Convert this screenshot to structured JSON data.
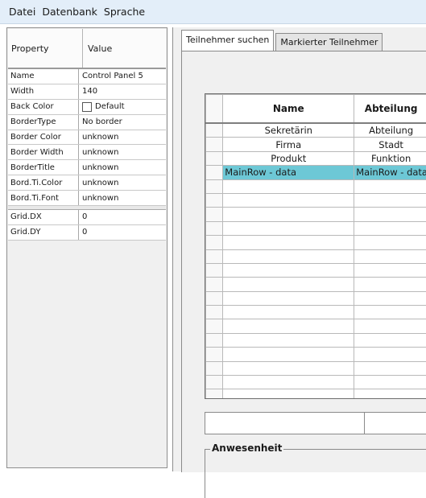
{
  "menu": [
    "Datei",
    "Datenbank",
    "Sprache"
  ],
  "props": {
    "header": {
      "name": "Property",
      "value": "Value"
    },
    "rows": [
      {
        "name": "Name",
        "value": "Control Panel 5"
      },
      {
        "name": "Width",
        "value": "140"
      },
      {
        "name": "Back Color",
        "value": "Default",
        "swatch": true
      },
      {
        "name": "BorderType",
        "value": "No border"
      },
      {
        "name": "Border Color",
        "value": "unknown"
      },
      {
        "name": "Border Width",
        "value": "unknown"
      },
      {
        "name": "BorderTitle",
        "value": "unknown"
      },
      {
        "name": "Bord.Ti.Color",
        "value": "unknown"
      },
      {
        "name": "Bord.Ti.Font",
        "value": "unknown"
      }
    ],
    "grid_rows": [
      {
        "name": "Grid.DX",
        "value": "0"
      },
      {
        "name": "Grid.DY",
        "value": "0"
      }
    ]
  },
  "tabs": [
    {
      "label": "Teilnehmer suchen",
      "active": true
    },
    {
      "label": "Markierter Teilnehmer",
      "active": false
    }
  ],
  "grid": {
    "columns": [
      "Name",
      "Abteilung"
    ],
    "rows": [
      [
        "Sekretärin",
        "Abteilung"
      ],
      [
        "Firma",
        "Stadt"
      ],
      [
        "Produkt",
        "Funktion"
      ],
      [
        "MainRow - data",
        "MainRow - data"
      ],
      [
        "",
        ""
      ],
      [
        "",
        ""
      ],
      [
        "",
        ""
      ],
      [
        "",
        ""
      ],
      [
        "",
        ""
      ],
      [
        "",
        ""
      ],
      [
        "",
        ""
      ],
      [
        "",
        ""
      ],
      [
        "",
        ""
      ],
      [
        "",
        ""
      ],
      [
        "",
        ""
      ],
      [
        "",
        ""
      ],
      [
        "",
        ""
      ],
      [
        "",
        ""
      ],
      [
        "",
        ""
      ],
      [
        "",
        ""
      ]
    ],
    "selected_row": 3,
    "selection_color": "#6dc8d6"
  },
  "group": {
    "title": "Anwesenheit"
  }
}
